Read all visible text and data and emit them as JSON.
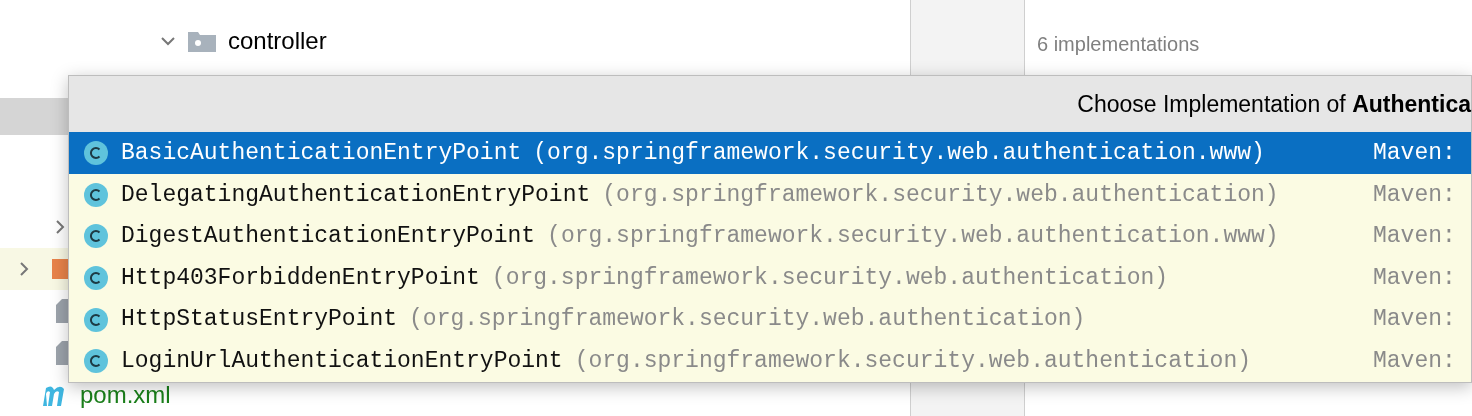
{
  "project_tree": {
    "items": [
      {
        "label": "controller",
        "kind": "folder",
        "expanded": true
      },
      {
        "label": "pom.xml",
        "kind": "maven"
      }
    ]
  },
  "doc_panel": {
    "count": "6 implementations"
  },
  "popup": {
    "title": "Choose Implementation of **Authentica**",
    "items": [
      {
        "name": "BasicAuthenticationEntryPoint",
        "package": "(org.springframework.security.web.authentication.www)",
        "source": "Maven:",
        "selected": true
      },
      {
        "name": "DelegatingAuthenticationEntryPoint",
        "package": "(org.springframework.security.web.authentication)",
        "source": "Maven:",
        "selected": false
      },
      {
        "name": "DigestAuthenticationEntryPoint",
        "package": "(org.springframework.security.web.authentication.www)",
        "source": "Maven:",
        "selected": false
      },
      {
        "name": "Http403ForbiddenEntryPoint",
        "package": "(org.springframework.security.web.authentication)",
        "source": "Maven:",
        "selected": false
      },
      {
        "name": "HttpStatusEntryPoint",
        "package": "(org.springframework.security.web.authentication)",
        "source": "Maven:",
        "selected": false
      },
      {
        "name": "LoginUrlAuthenticationEntryPoint",
        "package": "(org.springframework.security.web.authentication)",
        "source": "Maven:",
        "selected": false
      }
    ]
  }
}
